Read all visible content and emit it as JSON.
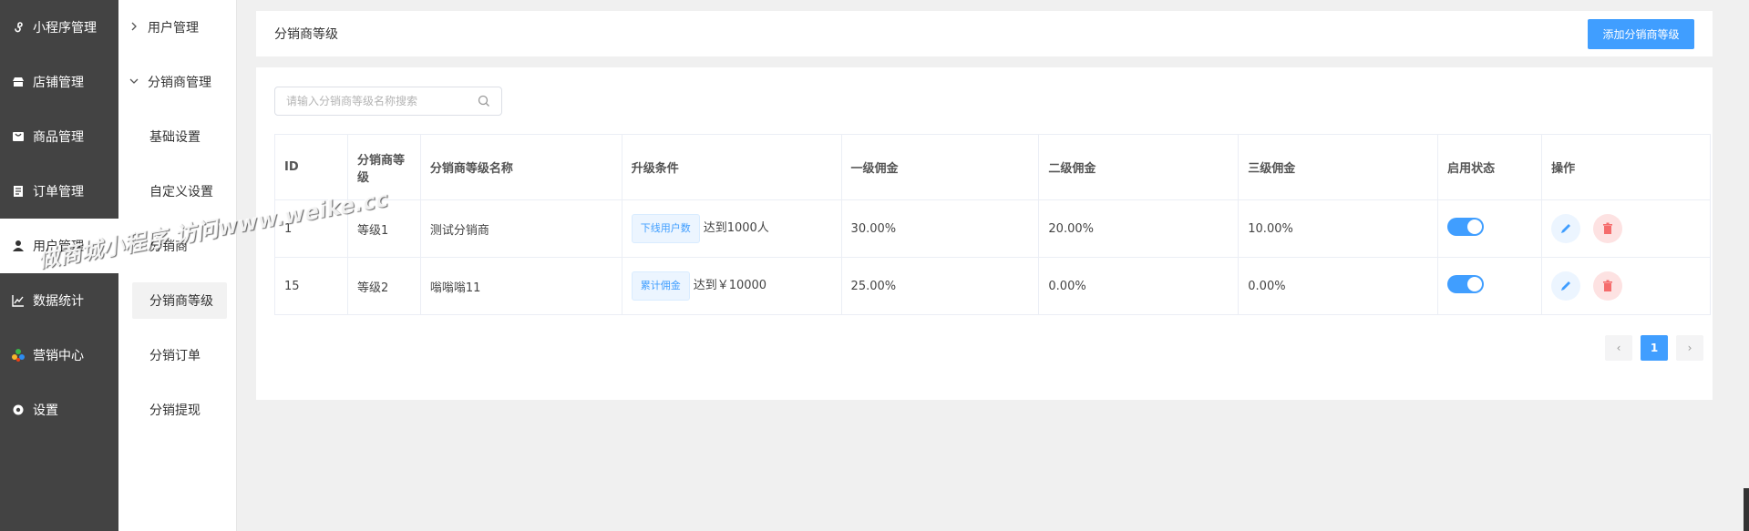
{
  "sidebar_main": {
    "items": [
      {
        "label": "小程序管理",
        "icon": "mini-program-icon"
      },
      {
        "label": "店铺管理",
        "icon": "store-icon"
      },
      {
        "label": "商品管理",
        "icon": "goods-icon"
      },
      {
        "label": "订单管理",
        "icon": "order-icon"
      },
      {
        "label": "用户管理",
        "icon": "user-icon",
        "active": true
      },
      {
        "label": "数据统计",
        "icon": "chart-icon"
      },
      {
        "label": "营销中心",
        "icon": "marketing-icon"
      },
      {
        "label": "设置",
        "icon": "gear-icon"
      }
    ]
  },
  "sidebar_sub": {
    "group1": "用户管理",
    "group2": "分销商管理",
    "children": [
      "基础设置",
      "自定义设置",
      "分销商",
      "分销商等级",
      "分销订单",
      "分销提现"
    ]
  },
  "header": {
    "title": "分销商等级",
    "add_button": "添加分销商等级"
  },
  "search": {
    "placeholder": "请输入分销商等级名称搜索"
  },
  "table": {
    "headers": [
      "ID",
      "分销商等级",
      "分销商等级名称",
      "升级条件",
      "一级佣金",
      "二级佣金",
      "三级佣金",
      "启用状态",
      "操作"
    ],
    "rows": [
      {
        "id": "1",
        "level": "等级1",
        "name": "测试分销商",
        "cond_tag": "下线用户数",
        "cond_text": "达到1000人",
        "c1": "30.00%",
        "c2": "20.00%",
        "c3": "10.00%",
        "enabled": true
      },
      {
        "id": "15",
        "level": "等级2",
        "name": "嗡嗡嗡11",
        "cond_tag": "累计佣金",
        "cond_text": "达到￥10000",
        "c1": "25.00%",
        "c2": "0.00%",
        "c3": "0.00%",
        "enabled": true
      }
    ]
  },
  "pagination": {
    "current": "1",
    "prev": "‹",
    "next": "›"
  },
  "watermark": "做商城小程序 访问www.weike.cc",
  "colors": {
    "sidebar_bg": "#434343",
    "primary": "#409eff",
    "danger": "#f56c6c"
  }
}
